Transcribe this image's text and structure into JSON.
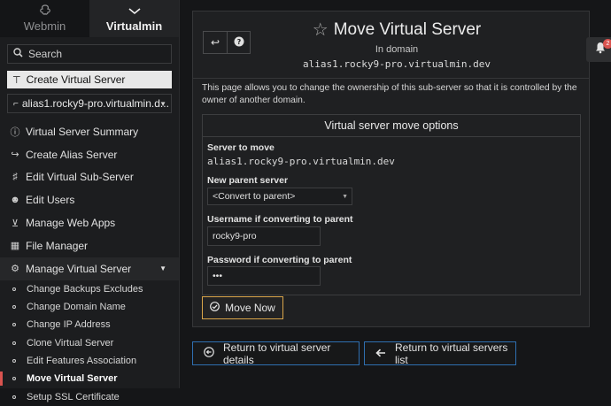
{
  "sidebar": {
    "tabs": [
      {
        "label": "Webmin",
        "icon": "webmin-logo-icon"
      },
      {
        "label": "Virtualmin",
        "icon": "chevron-down-icon"
      }
    ],
    "search_label": "Search",
    "create_label": "Create Virtual Server",
    "domain_selected": "alias1.rocky9-pro.virtualmin.d...",
    "menu": [
      {
        "label": "Virtual Server Summary",
        "icon": "info-icon"
      },
      {
        "label": "Create Alias Server",
        "icon": "share-icon"
      },
      {
        "label": "Edit Virtual Sub-Server",
        "icon": "sliders-icon"
      },
      {
        "label": "Edit Users",
        "icon": "users-icon"
      },
      {
        "label": "Manage Web Apps",
        "icon": "download-icon"
      },
      {
        "label": "File Manager",
        "icon": "folder-icon"
      },
      {
        "label": "Manage Virtual Server",
        "icon": "gears-icon"
      }
    ],
    "submenu": [
      "Change Backups Excludes",
      "Change Domain Name",
      "Change IP Address",
      "Clone Virtual Server",
      "Edit Features Association",
      "Move Virtual Server",
      "Setup SSL Certificate"
    ]
  },
  "page": {
    "title": "Move Virtual Server",
    "subtitle": "In domain",
    "domain": "alias1.rocky9-pro.virtualmin.dev",
    "intro": "This page allows you to change the ownership of this sub-server so that it is controlled by the owner of another domain.",
    "options_title": "Virtual server move options",
    "server_to_move_label": "Server to move",
    "server_to_move_value": "alias1.rocky9-pro.virtualmin.dev",
    "new_parent_label": "New parent server",
    "new_parent_value": "<Convert to parent>",
    "username_label": "Username if converting to parent",
    "username_value": "rocky9-pro",
    "password_label": "Password if converting to parent",
    "password_value": "•••",
    "move_button": "Move Now",
    "return_details": "Return to virtual server details",
    "return_list": "Return to virtual servers list",
    "notification_count": "2"
  },
  "colors": {
    "accent_red": "#d9534f",
    "move_button_border": "#d9a54a",
    "return_button_border": "#2f6fb0"
  }
}
